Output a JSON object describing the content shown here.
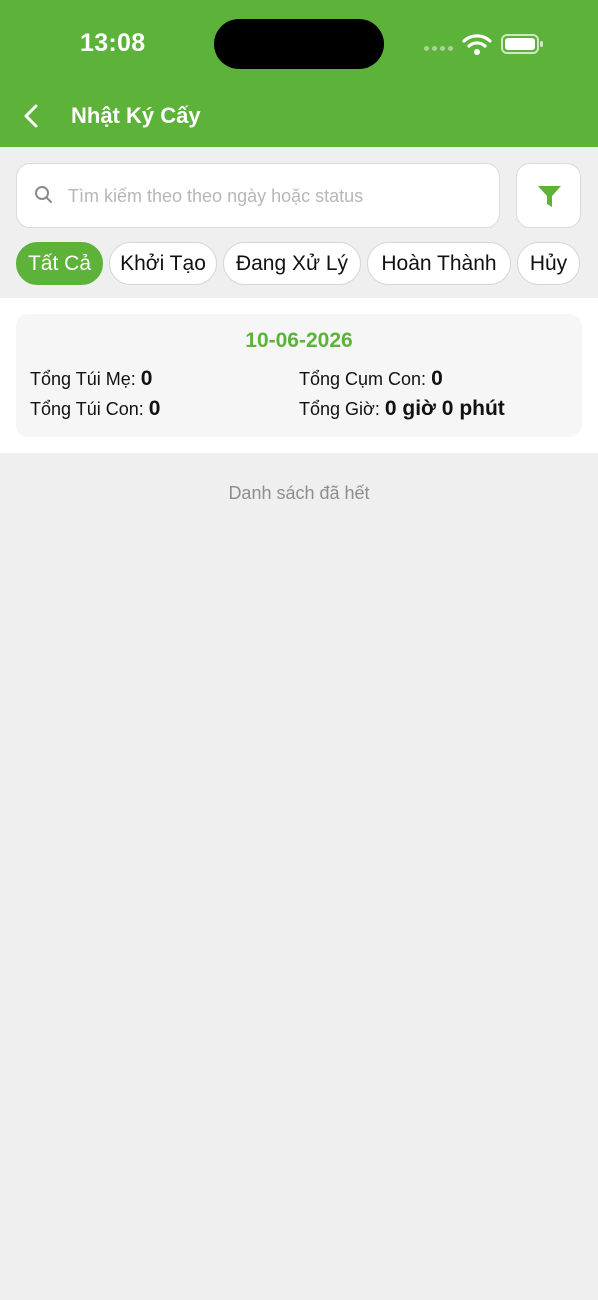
{
  "status_bar": {
    "time": "13:08"
  },
  "header": {
    "title": "Nhật Ký Cấy"
  },
  "search": {
    "placeholder": "Tìm kiếm theo theo ngày hoặc status",
    "value": ""
  },
  "tabs": [
    {
      "label": "Tất Cả",
      "active": true
    },
    {
      "label": "Khởi Tạo",
      "active": false
    },
    {
      "label": "Đang Xử Lý",
      "active": false
    },
    {
      "label": "Hoàn Thành",
      "active": false
    },
    {
      "label": "Hủy",
      "active": false
    }
  ],
  "entries": [
    {
      "date": "10-06-2026",
      "stats": {
        "tong_tui_me": {
          "label": "Tổng Túi Mẹ:",
          "value": "0"
        },
        "tong_cum_con": {
          "label": "Tổng Cụm Con:",
          "value": "0"
        },
        "tong_tui_con": {
          "label": "Tổng Túi Con:",
          "value": "0"
        },
        "tong_gio": {
          "label": "Tổng Giờ:",
          "value": "0 giờ 0 phút"
        }
      }
    }
  ],
  "list_end_text": "Danh sách đã hết",
  "colors": {
    "primary": "#5db239",
    "background": "#efefef",
    "card": "#f6f6f6"
  },
  "icons": {
    "back": "chevron-left-icon",
    "search": "search-icon",
    "filter": "filter-icon"
  }
}
